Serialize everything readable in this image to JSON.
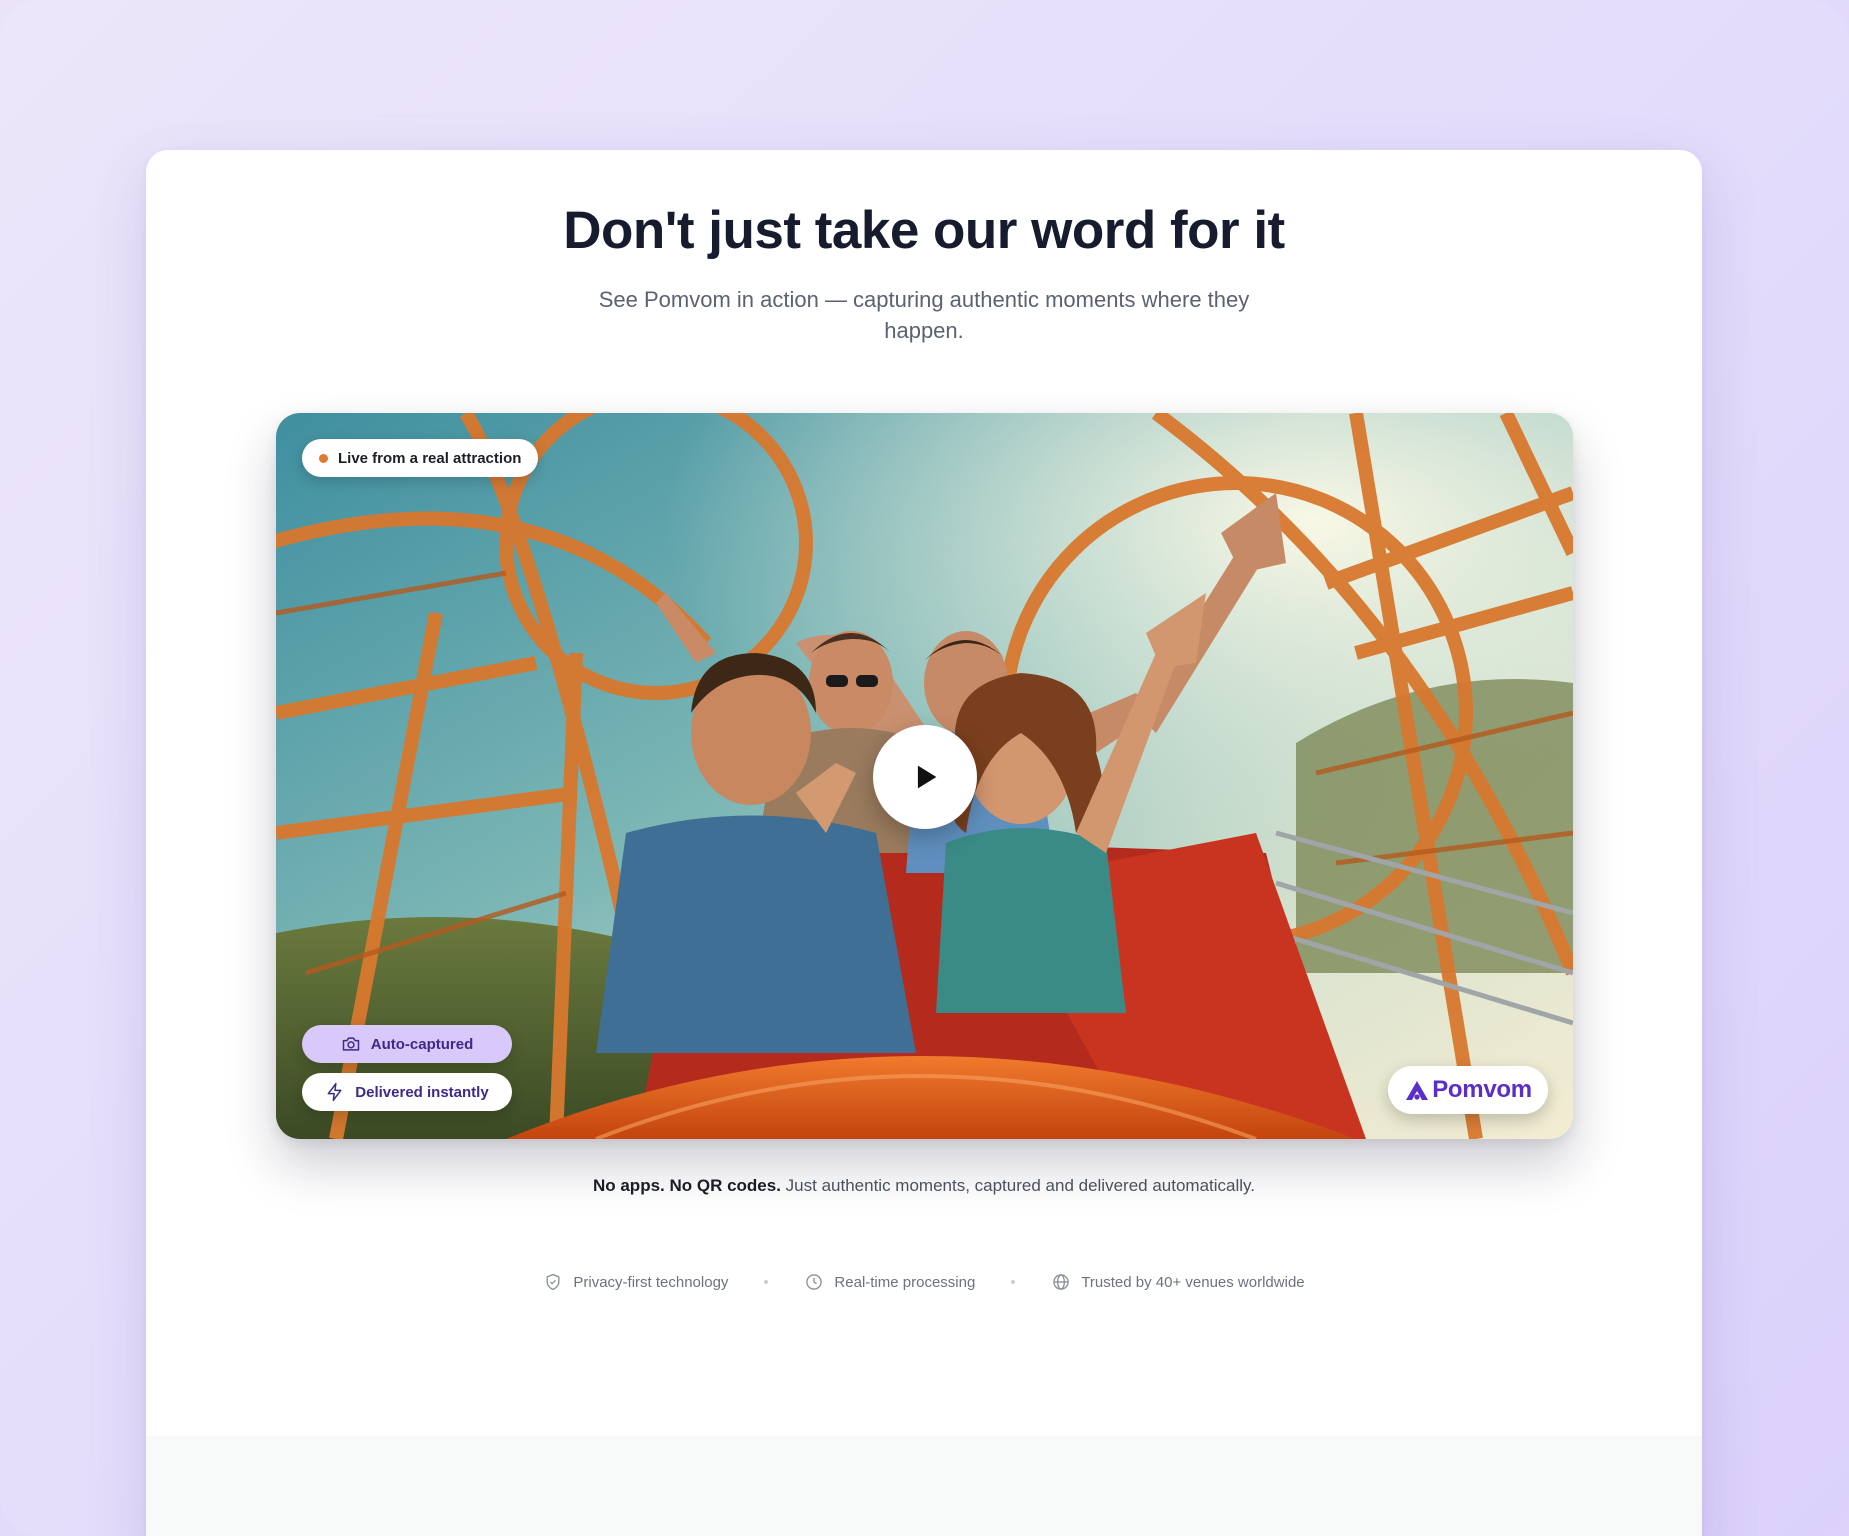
{
  "section": {
    "headline": "Don't just take our word for it",
    "subhead": "See Pomvom in action — capturing authentic moments where they happen."
  },
  "video": {
    "live_badge": "Live from a real attraction",
    "auto_captured": "Auto-captured",
    "delivered_instantly": "Delivered instantly",
    "brand": "Pomvom",
    "play_icon": "play-icon"
  },
  "tagline": {
    "bold": "No apps. No QR codes.",
    "rest": " Just authentic moments, captured and delivered automatically."
  },
  "features": [
    {
      "icon": "shield-check-icon",
      "label": "Privacy-first technology"
    },
    {
      "icon": "clock-icon",
      "label": "Real-time processing"
    },
    {
      "icon": "globe-icon",
      "label": "Trusted by 40+ venues worldwide"
    }
  ],
  "colors": {
    "accent": "#5a2fc8",
    "accent_light": "#d9c9fb",
    "live_dot": "#e07a2e",
    "headline": "#161b2e"
  }
}
